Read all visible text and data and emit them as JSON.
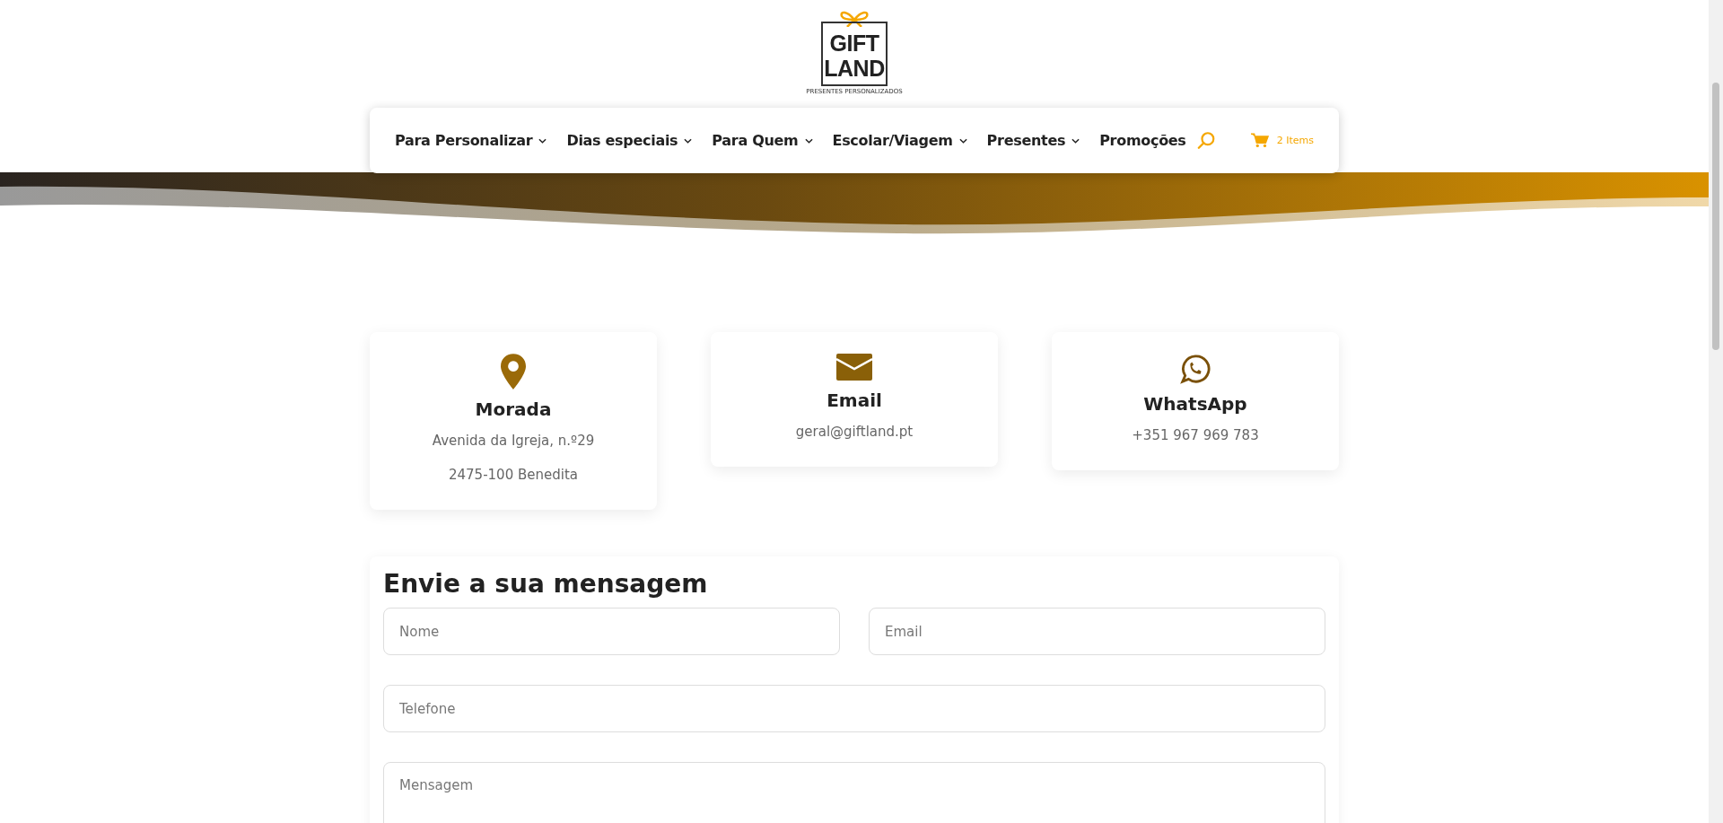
{
  "logo": {
    "line_1": "GIFT",
    "line_2": "LAND",
    "tagline": "PRESENTES PERSONALIZADOS"
  },
  "nav": {
    "items": [
      {
        "label": "Para Personalizar",
        "has_submenu": true
      },
      {
        "label": "Dias especiais",
        "has_submenu": true
      },
      {
        "label": "Para Quem",
        "has_submenu": true
      },
      {
        "label": "Escolar/Viagem",
        "has_submenu": true
      },
      {
        "label": "Presentes",
        "has_submenu": true
      },
      {
        "label": "Promoções",
        "has_submenu": false
      }
    ],
    "cart": {
      "count": "2 Items"
    }
  },
  "contact_cards": [
    {
      "kind": "pin",
      "title": "Morada",
      "lines": [
        "Avenida da Igreja, n.º29",
        "2475-100 Benedita"
      ]
    },
    {
      "kind": "mail",
      "title": "Email",
      "lines": [
        "geral@giftland.pt"
      ]
    },
    {
      "kind": "whatsapp",
      "title": "WhatsApp",
      "lines": [
        "+351 967 969 783"
      ]
    }
  ],
  "form": {
    "title": "Envie a sua mensagem",
    "fields": [
      {
        "kind": "half",
        "placeholder": "Nome"
      },
      {
        "kind": "half",
        "placeholder": "Email"
      },
      {
        "kind": "full",
        "placeholder": "Telefone"
      },
      {
        "kind": "textarea",
        "placeholder": "Mensagem"
      }
    ]
  }
}
